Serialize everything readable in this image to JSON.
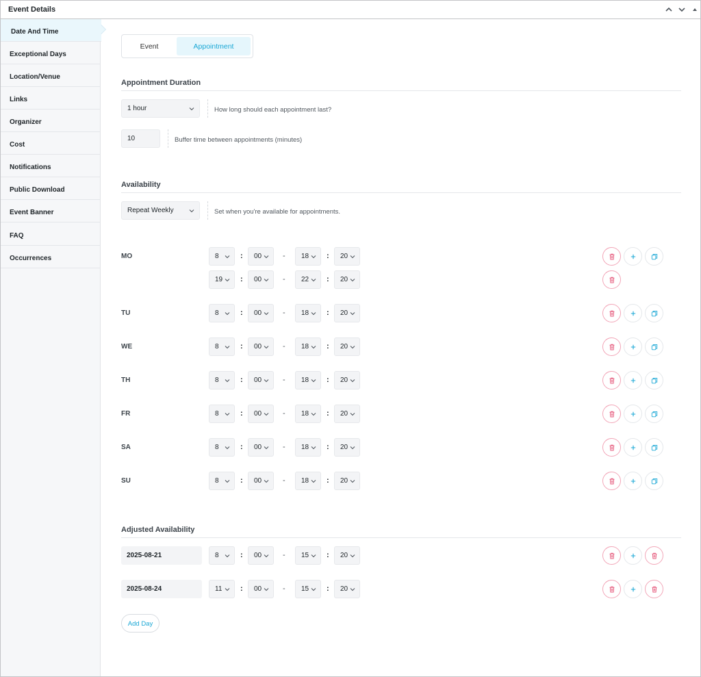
{
  "panel": {
    "title": "Event Details"
  },
  "sidebar": {
    "items": [
      {
        "label": "Date And Time",
        "active": true
      },
      {
        "label": "Exceptional Days"
      },
      {
        "label": "Location/Venue"
      },
      {
        "label": "Links"
      },
      {
        "label": "Organizer"
      },
      {
        "label": "Cost"
      },
      {
        "label": "Notifications"
      },
      {
        "label": "Public Download"
      },
      {
        "label": "Event Banner"
      },
      {
        "label": "FAQ"
      },
      {
        "label": "Occurrences"
      }
    ]
  },
  "tabs": {
    "event": "Event",
    "appointment": "Appointment",
    "active": "appointment"
  },
  "duration": {
    "title": "Appointment Duration",
    "duration_value": "1 hour",
    "duration_hint": "How long should each appointment last?",
    "buffer_value": "10",
    "buffer_hint": "Buffer time between appointments (minutes)"
  },
  "availability": {
    "title": "Availability",
    "repeat_value": "Repeat Weekly",
    "repeat_hint": "Set when you're available for appointments.",
    "days": [
      {
        "label": "MO",
        "slots": [
          [
            "8",
            "00",
            "18",
            "20"
          ],
          [
            "19",
            "00",
            "22",
            "20"
          ]
        ]
      },
      {
        "label": "TU",
        "slots": [
          [
            "8",
            "00",
            "18",
            "20"
          ]
        ]
      },
      {
        "label": "WE",
        "slots": [
          [
            "8",
            "00",
            "18",
            "20"
          ]
        ]
      },
      {
        "label": "TH",
        "slots": [
          [
            "8",
            "00",
            "18",
            "20"
          ]
        ]
      },
      {
        "label": "FR",
        "slots": [
          [
            "8",
            "00",
            "18",
            "20"
          ]
        ]
      },
      {
        "label": "SA",
        "slots": [
          [
            "8",
            "00",
            "18",
            "20"
          ]
        ]
      },
      {
        "label": "SU",
        "slots": [
          [
            "8",
            "00",
            "18",
            "20"
          ]
        ]
      }
    ]
  },
  "adjusted": {
    "title": "Adjusted Availability",
    "rows": [
      {
        "date": "2025-08-21",
        "slot": [
          "8",
          "00",
          "15",
          "20"
        ]
      },
      {
        "date": "2025-08-24",
        "slot": [
          "11",
          "00",
          "15",
          "20"
        ]
      }
    ],
    "add_day_label": "Add Day"
  },
  "separators": {
    "colon": ":",
    "dash": "-"
  },
  "colors": {
    "accent": "#19a7d5",
    "danger": "#e5577a",
    "tab_active_bg": "#e5f6fc"
  },
  "icons": {
    "delete": "trash-icon",
    "add": "plus-icon",
    "copy": "copy-icon"
  }
}
